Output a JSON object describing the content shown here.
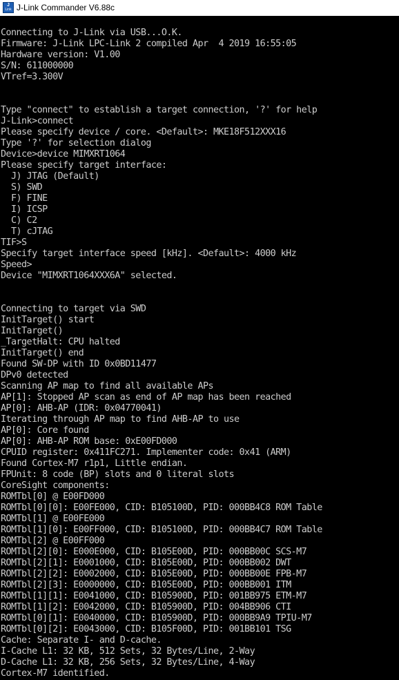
{
  "window": {
    "title": "J-Link Commander V6.88c",
    "icon": "jlink-app-icon",
    "icon_text_top": "J",
    "icon_text_bottom": "Link"
  },
  "console": {
    "text_color": "#cccccc",
    "background": "#000000",
    "lines": [
      "Connecting to J-Link via USB...O.K.",
      "Firmware: J-Link LPC-Link 2 compiled Apr  4 2019 16:55:05",
      "Hardware version: V1.00",
      "S/N: 611000000",
      "VTref=3.300V",
      "",
      "",
      "Type \"connect\" to establish a target connection, '?' for help",
      "J-Link>connect",
      "Please specify device / core. <Default>: MKE18F512XXX16",
      "Type '?' for selection dialog",
      "Device>device MIMXRT1064",
      "Please specify target interface:",
      "  J) JTAG (Default)",
      "  S) SWD",
      "  F) FINE",
      "  I) ICSP",
      "  C) C2",
      "  T) cJTAG",
      "TIF>S",
      "Specify target interface speed [kHz]. <Default>: 4000 kHz",
      "Speed>",
      "Device \"MIMXRT1064XXX6A\" selected.",
      "",
      "",
      "Connecting to target via SWD",
      "InitTarget() start",
      "InitTarget()",
      "_TargetHalt: CPU halted",
      "InitTarget() end",
      "Found SW-DP with ID 0x0BD11477",
      "DPv0 detected",
      "Scanning AP map to find all available APs",
      "AP[1]: Stopped AP scan as end of AP map has been reached",
      "AP[0]: AHB-AP (IDR: 0x04770041)",
      "Iterating through AP map to find AHB-AP to use",
      "AP[0]: Core found",
      "AP[0]: AHB-AP ROM base: 0xE00FD000",
      "CPUID register: 0x411FC271. Implementer code: 0x41 (ARM)",
      "Found Cortex-M7 r1p1, Little endian.",
      "FPUnit: 8 code (BP) slots and 0 literal slots",
      "CoreSight components:",
      "ROMTbl[0] @ E00FD000",
      "ROMTbl[0][0]: E00FE000, CID: B105100D, PID: 000BB4C8 ROM Table",
      "ROMTbl[1] @ E00FE000",
      "ROMTbl[1][0]: E00FF000, CID: B105100D, PID: 000BB4C7 ROM Table",
      "ROMTbl[2] @ E00FF000",
      "ROMTbl[2][0]: E000E000, CID: B105E00D, PID: 000BB00C SCS-M7",
      "ROMTbl[2][1]: E0001000, CID: B105E00D, PID: 000BB002 DWT",
      "ROMTbl[2][2]: E0002000, CID: B105E00D, PID: 000BB00E FPB-M7",
      "ROMTbl[2][3]: E0000000, CID: B105E00D, PID: 000BB001 ITM",
      "ROMTbl[1][1]: E0041000, CID: B105900D, PID: 001BB975 ETM-M7",
      "ROMTbl[1][2]: E0042000, CID: B105900D, PID: 004BB906 CTI",
      "ROMTbl[0][1]: E0040000, CID: B105900D, PID: 000BB9A9 TPIU-M7",
      "ROMTbl[0][2]: E0043000, CID: B105F00D, PID: 001BB101 TSG",
      "Cache: Separate I- and D-cache.",
      "I-Cache L1: 32 KB, 512 Sets, 32 Bytes/Line, 2-Way",
      "D-Cache L1: 32 KB, 256 Sets, 32 Bytes/Line, 4-Way",
      "Cortex-M7 identified."
    ]
  }
}
